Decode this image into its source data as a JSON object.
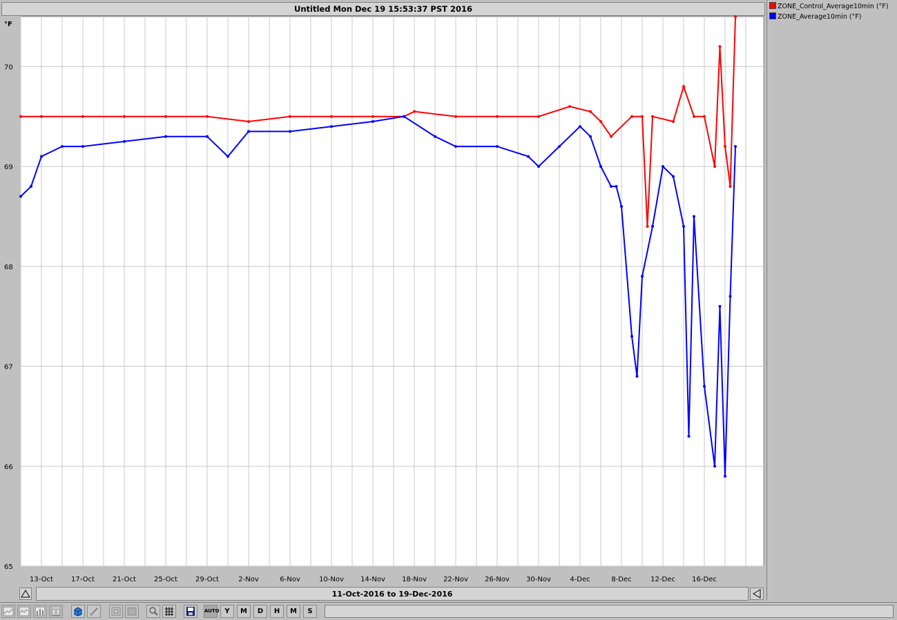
{
  "window": {
    "title": "Untitled Mon Dec 19 15:53:37 PST 2016",
    "unit_label": "°F",
    "range_label": "11-Oct-2016 to 19-Dec-2016"
  },
  "legend": [
    {
      "label": "ZONE_Control_Average10min (°F)",
      "color": "#ff0000"
    },
    {
      "label": "ZONE_Average10min (°F)",
      "color": "#0000ff"
    }
  ],
  "toolbar": {
    "auto_label": "AUTO",
    "year_label": "Y",
    "month_label": "M",
    "day_label": "D",
    "hour_label": "H",
    "minute_label": "M",
    "second_label": "S",
    "icons": [
      "area-chart-icon",
      "line-chart-icon",
      "bar-chart-icon",
      "column-chart-icon",
      "3d-box-icon",
      "brush-icon",
      "zoom-region-icon",
      "zoom-out-region-icon",
      "zoom-icon",
      "grid-icon",
      "save-icon"
    ]
  },
  "chart_data": {
    "type": "line",
    "title": "Untitled Mon Dec 19 15:53:37 PST 2016",
    "xlabel": "11-Oct-2016 to 19-Dec-2016",
    "ylabel": "°F",
    "ylim": [
      65,
      70.5
    ],
    "yticks": [
      65,
      66,
      67,
      68,
      69,
      70
    ],
    "xticks": [
      "13-Oct",
      "17-Oct",
      "21-Oct",
      "25-Oct",
      "29-Oct",
      "2-Nov",
      "6-Nov",
      "10-Nov",
      "14-Nov",
      "18-Nov",
      "22-Nov",
      "26-Nov",
      "30-Nov",
      "4-Dec",
      "8-Dec",
      "12-Dec",
      "16-Dec"
    ],
    "grid": true,
    "legend_position": "right",
    "series": [
      {
        "name": "ZONE_Control_Average10min (°F)",
        "color": "#ff0000",
        "x": [
          "2016-10-11",
          "2016-10-13",
          "2016-10-17",
          "2016-10-21",
          "2016-10-25",
          "2016-10-29",
          "2016-11-02",
          "2016-11-06",
          "2016-11-10",
          "2016-11-14",
          "2016-11-17",
          "2016-11-18",
          "2016-11-22",
          "2016-11-26",
          "2016-11-30",
          "2016-12-03",
          "2016-12-05",
          "2016-12-06",
          "2016-12-07",
          "2016-12-09",
          "2016-12-10",
          "2016-12-10T12:00",
          "2016-12-11",
          "2016-12-13",
          "2016-12-14",
          "2016-12-15",
          "2016-12-16",
          "2016-12-17",
          "2016-12-17T12:00",
          "2016-12-18",
          "2016-12-18T12:00",
          "2016-12-19"
        ],
        "y": [
          69.5,
          69.5,
          69.5,
          69.5,
          69.5,
          69.5,
          69.45,
          69.5,
          69.5,
          69.5,
          69.5,
          69.55,
          69.5,
          69.5,
          69.5,
          69.6,
          69.55,
          69.45,
          69.3,
          69.5,
          69.5,
          68.4,
          69.5,
          69.45,
          69.8,
          69.5,
          69.5,
          69.0,
          70.2,
          69.2,
          68.8,
          70.5
        ]
      },
      {
        "name": "ZONE_Average10min (°F)",
        "color": "#0000ff",
        "x": [
          "2016-10-11",
          "2016-10-12",
          "2016-10-13",
          "2016-10-15",
          "2016-10-17",
          "2016-10-21",
          "2016-10-25",
          "2016-10-29",
          "2016-10-31",
          "2016-11-02",
          "2016-11-06",
          "2016-11-10",
          "2016-11-14",
          "2016-11-17",
          "2016-11-20",
          "2016-11-22",
          "2016-11-26",
          "2016-11-29",
          "2016-11-30",
          "2016-12-02",
          "2016-12-04",
          "2016-12-05",
          "2016-12-06",
          "2016-12-07",
          "2016-12-07T12:00",
          "2016-12-08",
          "2016-12-09",
          "2016-12-09T12:00",
          "2016-12-10",
          "2016-12-11",
          "2016-12-12",
          "2016-12-13",
          "2016-12-14",
          "2016-12-14T12:00",
          "2016-12-15",
          "2016-12-16",
          "2016-12-17",
          "2016-12-17T12:00",
          "2016-12-18",
          "2016-12-18T12:00",
          "2016-12-19"
        ],
        "y": [
          68.7,
          68.8,
          69.1,
          69.2,
          69.2,
          69.25,
          69.3,
          69.3,
          69.1,
          69.35,
          69.35,
          69.4,
          69.45,
          69.5,
          69.3,
          69.2,
          69.2,
          69.1,
          69.0,
          69.2,
          69.4,
          69.3,
          69.0,
          68.8,
          68.8,
          68.6,
          67.3,
          66.9,
          67.9,
          68.4,
          69.0,
          68.9,
          68.4,
          66.3,
          68.5,
          66.8,
          66.0,
          67.6,
          65.9,
          67.7,
          69.2
        ]
      }
    ]
  }
}
